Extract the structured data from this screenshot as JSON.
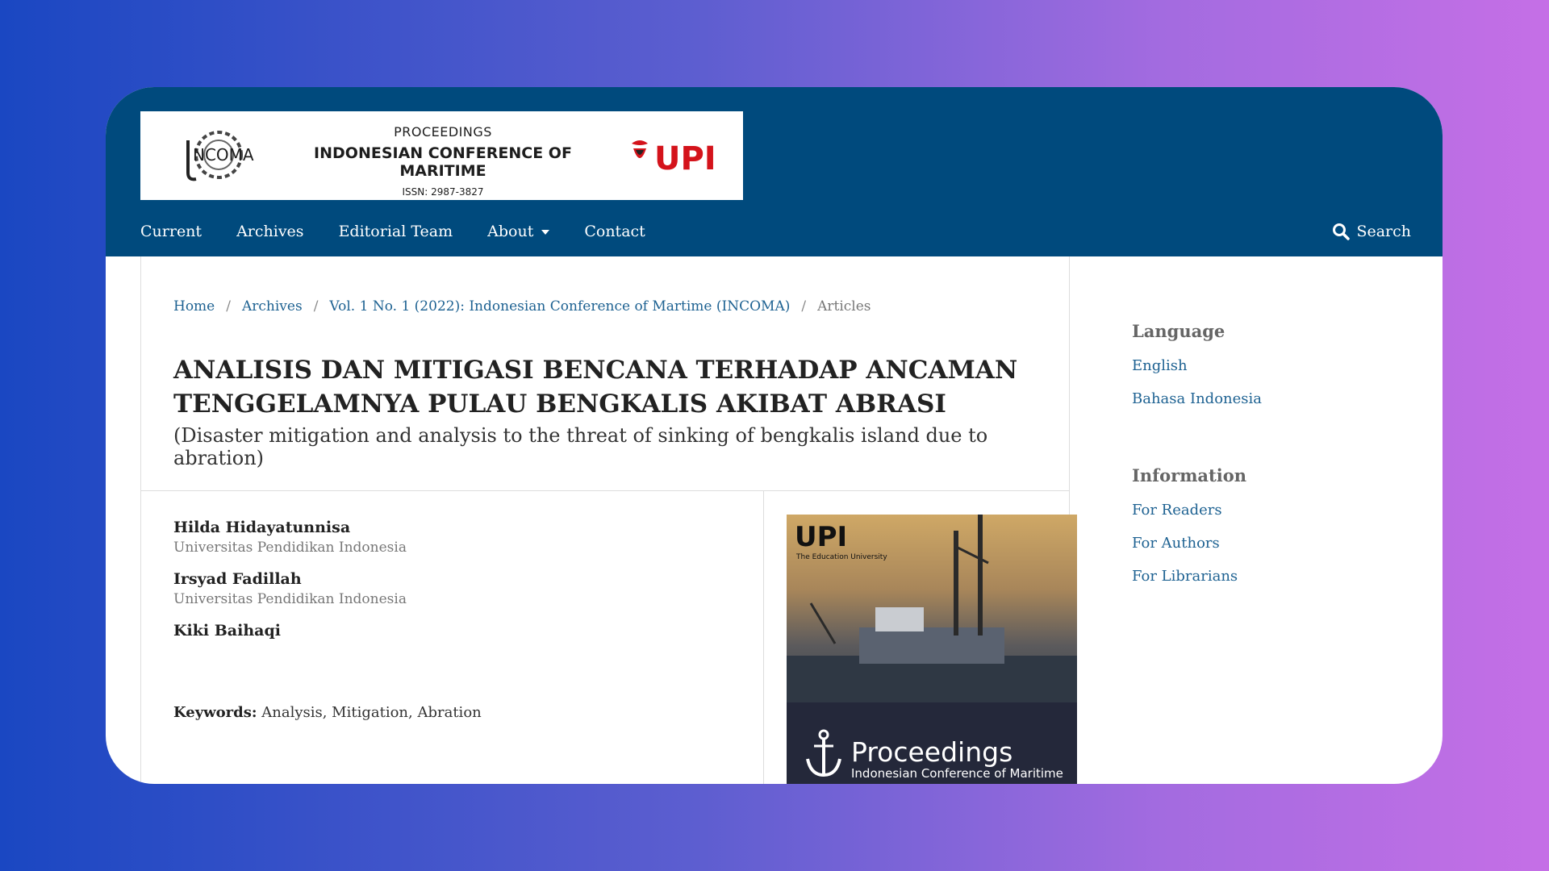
{
  "logo": {
    "small_text": "PROCEEDINGS",
    "main_text": "INDONESIAN CONFERENCE OF MARITIME",
    "issn": "ISSN: 2987-3827",
    "emblem_text": "NCOMA",
    "upi_text": "UPI"
  },
  "nav": {
    "items": [
      "Current",
      "Archives",
      "Editorial Team",
      "About",
      "Contact"
    ],
    "search_label": "Search"
  },
  "breadcrumb": {
    "home": "Home",
    "archives": "Archives",
    "issue": "Vol. 1 No. 1 (2022): Indonesian Conference of Martime (INCOMA)",
    "current": "Articles",
    "separator": "/"
  },
  "article": {
    "title": "ANALISIS DAN MITIGASI BENCANA TERHADAP ANCAMAN TENGGELAMNYA PULAU BENGKALIS AKIBAT ABRASI",
    "subtitle": "(Disaster mitigation and analysis to the threat of sinking of bengkalis island due to abration)",
    "authors": [
      {
        "name": "Hilda Hidayatunnisa",
        "affiliation": "Universitas Pendidikan Indonesia"
      },
      {
        "name": "Irsyad Fadillah",
        "affiliation": "Universitas Pendidikan Indonesia"
      },
      {
        "name": "Kiki Baihaqi",
        "affiliation": ""
      }
    ],
    "keywords_label": "Keywords:",
    "keywords": "Analysis, Mitigation, Abration"
  },
  "cover": {
    "upi": "UPI",
    "upi_sub": "The Education University",
    "title": "Proceedings",
    "subtitle": "Indonesian Conference of Maritime"
  },
  "sidebar": {
    "language_heading": "Language",
    "languages": [
      "English",
      "Bahasa Indonesia"
    ],
    "information_heading": "Information",
    "info_links": [
      "For Readers",
      "For Authors",
      "For Librarians"
    ]
  },
  "colors": {
    "header": "#004a7d",
    "link": "#1e6292",
    "upi_red": "#d4131b"
  }
}
